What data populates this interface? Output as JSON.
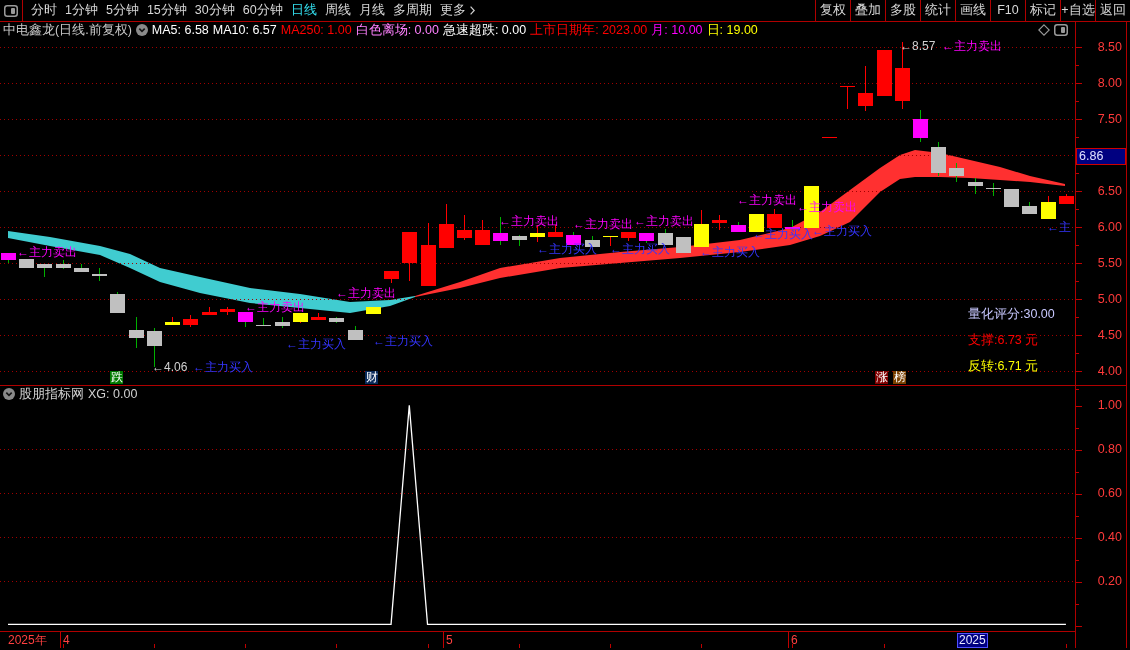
{
  "toolbar": {
    "periods": [
      {
        "label": "分时",
        "selected": false
      },
      {
        "label": "1分钟",
        "selected": false
      },
      {
        "label": "5分钟",
        "selected": false
      },
      {
        "label": "15分钟",
        "selected": false
      },
      {
        "label": "30分钟",
        "selected": false
      },
      {
        "label": "60分钟",
        "selected": false
      },
      {
        "label": "日线",
        "selected": true
      },
      {
        "label": "周线",
        "selected": false
      },
      {
        "label": "月线",
        "selected": false
      },
      {
        "label": "多周期",
        "selected": false
      }
    ],
    "more": "更多",
    "actions": [
      "复权",
      "叠加",
      "多股",
      "统计",
      "画线",
      "F10",
      "标记",
      "+自选",
      "返回"
    ]
  },
  "info_bar": {
    "title": "中电鑫龙(日线.前复权)",
    "indicators": [
      {
        "label": "MA5: 6.58",
        "color": "#ffffff"
      },
      {
        "label": "MA10: 6.57",
        "color": "#ffffff"
      },
      {
        "label": "MA250: 1.00",
        "color": "#ff0000"
      },
      {
        "label": "白色离场: 0.00",
        "color": "#ff80ff"
      },
      {
        "label": "急速超跌: 0.00",
        "color": "#ffffff"
      },
      {
        "label": "上市日期年: 2023.00",
        "color": "#ff0000"
      },
      {
        "label": "月: 10.00",
        "color": "#ff00ff"
      },
      {
        "label": "日: 19.00",
        "color": "#ffff00"
      }
    ]
  },
  "main_chart": {
    "chart_data": {
      "type": "candlestick",
      "ylim": [
        3.81,
        8.63
      ],
      "grid": true,
      "yticks": [
        {
          "value": 8.5,
          "label": "8.50"
        },
        {
          "value": 8,
          "label": "8.00"
        },
        {
          "value": 7.5,
          "label": "7.50"
        },
        {
          "value": 6.5,
          "label": "6.50"
        },
        {
          "value": 6,
          "label": "6.00"
        },
        {
          "value": 5.5,
          "label": "5.50"
        },
        {
          "value": 5,
          "label": "5.00"
        },
        {
          "value": 4.5,
          "label": "4.50"
        },
        {
          "value": 4,
          "label": "4.00"
        }
      ],
      "ohlc": [
        [
          5.64,
          5.64,
          5.5,
          5.54
        ],
        [
          5.56,
          5.56,
          5.44,
          5.44
        ],
        [
          5.49,
          5.49,
          5.31,
          5.44
        ],
        [
          5.49,
          5.54,
          5.42,
          5.43
        ],
        [
          5.44,
          5.49,
          5.38,
          5.38
        ],
        [
          5.35,
          5.44,
          5.26,
          5.32
        ],
        [
          5.08,
          5.1,
          4.81,
          4.81
        ],
        [
          4.58,
          4.76,
          4.33,
          4.46
        ],
        [
          4.56,
          4.6,
          4.06,
          4.35
        ],
        [
          4.64,
          4.76,
          4.64,
          4.68
        ],
        [
          4.65,
          4.78,
          4.61,
          4.72
        ],
        [
          4.78,
          4.89,
          4.78,
          4.83
        ],
        [
          4.82,
          4.9,
          4.78,
          4.86
        ],
        [
          4.82,
          4.82,
          4.61,
          4.68
        ],
        [
          4.65,
          4.74,
          4.64,
          4.64
        ],
        [
          4.69,
          4.75,
          4.6,
          4.63
        ],
        [
          4.69,
          4.81,
          4.67,
          4.81
        ],
        [
          4.71,
          4.81,
          4.71,
          4.76
        ],
        [
          4.74,
          4.76,
          4.67,
          4.69
        ],
        [
          4.58,
          4.63,
          4.44,
          4.44
        ],
        [
          4.79,
          4.9,
          4.79,
          4.9
        ],
        [
          5.28,
          5.4,
          5.22,
          5.4
        ],
        [
          5.5,
          5.94,
          5.25,
          5.93
        ],
        [
          5.19,
          6.06,
          5.19,
          5.76
        ],
        [
          5.71,
          6.32,
          5.71,
          6.04
        ],
        [
          5.85,
          6.17,
          5.82,
          5.96
        ],
        [
          5.76,
          6.1,
          5.76,
          5.96
        ],
        [
          5.92,
          6.14,
          5.76,
          5.81
        ],
        [
          5.88,
          5.9,
          5.74,
          5.83
        ],
        [
          5.86,
          6.03,
          5.79,
          5.92
        ],
        [
          5.86,
          6.03,
          5.86,
          5.93
        ],
        [
          5.89,
          5.93,
          5.76,
          5.76
        ],
        [
          5.83,
          5.88,
          5.72,
          5.72
        ],
        [
          5.86,
          5.88,
          5.74,
          5.88
        ],
        [
          5.85,
          5.93,
          5.81,
          5.93
        ],
        [
          5.92,
          5.92,
          5.78,
          5.81
        ],
        [
          5.92,
          5.97,
          5.76,
          5.76
        ],
        [
          5.86,
          5.86,
          5.65,
          5.65
        ],
        [
          5.72,
          6.24,
          5.72,
          6.04
        ],
        [
          6.06,
          6.17,
          5.96,
          6.1
        ],
        [
          6.03,
          6.07,
          5.94,
          5.94
        ],
        [
          5.94,
          6.19,
          5.94,
          6.19
        ],
        [
          5.99,
          6.26,
          5.99,
          6.19
        ],
        [
          6.01,
          6.1,
          5.97,
          5.97
        ],
        [
          5.99,
          6.58,
          5.99,
          6.58
        ],
        [
          7.25,
          7.26,
          7.25,
          7.26
        ],
        [
          7.95,
          7.96,
          7.64,
          7.96
        ],
        [
          7.68,
          8.24,
          7.61,
          7.86
        ],
        [
          7.82,
          8.47,
          7.82,
          8.47
        ],
        [
          7.75,
          8.57,
          7.64,
          8.22
        ],
        [
          7.51,
          7.63,
          7.18,
          7.24
        ],
        [
          7.11,
          7.18,
          6.71,
          6.75
        ],
        [
          6.82,
          6.89,
          6.63,
          6.72
        ],
        [
          6.63,
          6.68,
          6.47,
          6.57
        ],
        [
          6.54,
          6.61,
          6.44,
          6.53
        ],
        [
          6.53,
          6.53,
          6.28,
          6.28
        ],
        [
          6.29,
          6.35,
          6.19,
          6.19
        ],
        [
          6.11,
          6.44,
          6.11,
          6.35
        ],
        [
          6.32,
          6.47,
          6.32,
          6.44
        ]
      ],
      "colors": [
        "#ff00ff",
        "#c0c0c0",
        "#c0c0c0",
        "#c0c0c0",
        "#c0c0c0",
        "#c0c0c0",
        "#c0c0c0",
        "#c0c0c0",
        "#c0c0c0",
        "#ffff00",
        "#ff0000",
        "#ff0000",
        "#ff0000",
        "#ff00ff",
        "#c0c0c0",
        "#c0c0c0",
        "#ffff00",
        "#ff0000",
        "#c0c0c0",
        "#c0c0c0",
        "#ffff00",
        "#ff0000",
        "#ff0000",
        "#ff0000",
        "#ff0000",
        "#ff0000",
        "#ff0000",
        "#ff00ff",
        "#c0c0c0",
        "#ffff00",
        "#ff0000",
        "#ff00ff",
        "#c0c0c0",
        "#ffff00",
        "#ff0000",
        "#ff00ff",
        "#c0c0c0",
        "#c0c0c0",
        "#ffff00",
        "#ff0000",
        "#ff00ff",
        "#ffff00",
        "#ff0000",
        "#ff00ff",
        "#ffff00",
        "#ff0000",
        "#ff0000",
        "#ff0000",
        "#ff0000",
        "#ff0000",
        "#ff00ff",
        "#c0c0c0",
        "#c0c0c0",
        "#c0c0c0",
        "#c0c0c0",
        "#c0c0c0",
        "#c0c0c0",
        "#ffff00",
        "#ff0000"
      ]
    },
    "cursor_price": "6.86",
    "extremes": [
      "←8.57",
      "←4.06"
    ],
    "signals": [
      {
        "kind": "sell",
        "text": "←主力卖出"
      },
      {
        "kind": "buy",
        "text": "←主力买入"
      },
      {
        "kind": "sell",
        "text": "←主力卖出"
      },
      {
        "kind": "buy",
        "text": "←主力买入"
      },
      {
        "kind": "sell",
        "text": "←主力卖出"
      },
      {
        "kind": "buy",
        "text": "←主力买入"
      },
      {
        "kind": "sell",
        "text": "←主力卖出"
      },
      {
        "kind": "buy",
        "text": "←主力买入"
      },
      {
        "kind": "sell",
        "text": "←主力卖出"
      },
      {
        "kind": "buy",
        "text": "←主力买入"
      },
      {
        "kind": "sell",
        "text": "←主力卖出"
      },
      {
        "kind": "buy",
        "text": "←主力买入"
      },
      {
        "kind": "sell",
        "text": "←主力卖出"
      },
      {
        "kind": "buy",
        "text": "←主力买入"
      },
      {
        "kind": "sell",
        "text": "←主力卖出"
      },
      {
        "kind": "buy",
        "text": "←主力买入"
      },
      {
        "kind": "sell",
        "text": "←主力卖出"
      },
      {
        "kind": "buy",
        "text": "←主"
      }
    ],
    "event_tags": [
      {
        "text": "跌",
        "color": "#007a00"
      },
      {
        "text": "财",
        "color": "#0a2a5a"
      },
      {
        "text": "涨",
        "color": "#800000"
      },
      {
        "text": "榜",
        "color": "#7a4000"
      }
    ],
    "stats": [
      {
        "text": "量化评分:30.00",
        "color": "#c8c8ff"
      },
      {
        "text": "支撑:6.73 元",
        "color": "#ff0000"
      },
      {
        "text": "反转:6.71 元",
        "color": "#ffff00"
      }
    ]
  },
  "indicator": {
    "title": "股朋指标网",
    "reading": ": 0.00",
    "chart_data": {
      "type": "line",
      "ylim": [
        -0.03,
        1.02
      ],
      "grid": true,
      "yticks": [
        {
          "value": 1,
          "label": "1.00"
        },
        {
          "value": 0.8,
          "label": "0.80"
        },
        {
          "value": 0.6,
          "label": "0.60"
        },
        {
          "value": 0.4,
          "label": "0.40"
        },
        {
          "value": 0.2,
          "label": "0.20"
        }
      ],
      "series": [
        {
          "name": "XG",
          "color": "#ffffff",
          "values": [
            0,
            0,
            0,
            0,
            0,
            0,
            0,
            0,
            0,
            0,
            0,
            0,
            0,
            0,
            0,
            0,
            0,
            0,
            0,
            0,
            0,
            0,
            1,
            0,
            0,
            0,
            0,
            0,
            0,
            0,
            0,
            0,
            0,
            0,
            0,
            0,
            0,
            0,
            0,
            0,
            0,
            0,
            0,
            0,
            0,
            0,
            0,
            0,
            0,
            0,
            0,
            0,
            0,
            0,
            0,
            0,
            0,
            0,
            0
          ]
        }
      ]
    }
  },
  "date_axis": {
    "labels": [
      "2025年",
      "4",
      "5",
      "6"
    ],
    "cursor_date": "2025"
  }
}
